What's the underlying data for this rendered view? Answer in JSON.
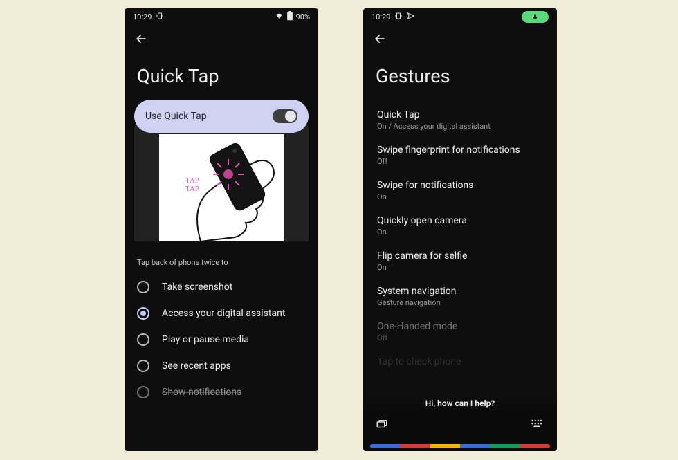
{
  "left": {
    "status": {
      "time": "10:29",
      "battery_text": "90%"
    },
    "title": "Quick Tap",
    "toggle_label": "Use Quick Tap",
    "illustration_caption": "TAP TAP",
    "section_label": "Tap back of phone twice to",
    "options": [
      {
        "label": "Take screenshot",
        "selected": false
      },
      {
        "label": "Access your digital assistant",
        "selected": true
      },
      {
        "label": "Play or pause media",
        "selected": false
      },
      {
        "label": "See recent apps",
        "selected": false
      },
      {
        "label": "Show notifications",
        "selected": false,
        "cutoff": true
      }
    ]
  },
  "right": {
    "status": {
      "time": "10:29"
    },
    "title": "Gestures",
    "items": [
      {
        "title": "Quick Tap",
        "sub": "On / Access your digital assistant"
      },
      {
        "title": "Swipe fingerprint for notifications",
        "sub": "Off"
      },
      {
        "title": "Swipe for notifications",
        "sub": "On"
      },
      {
        "title": "Quickly open camera",
        "sub": "On"
      },
      {
        "title": "Flip camera for selfie",
        "sub": "On"
      },
      {
        "title": "System navigation",
        "sub": "Gesture navigation"
      },
      {
        "title": "One-Handed mode",
        "sub": "Off",
        "dim": true
      },
      {
        "title": "Tap to check phone",
        "sub": "",
        "dim": true
      }
    ],
    "assistant_prompt": "Hi, how can I help?",
    "assistant_colors": [
      "#3a6bdd",
      "#d83a3a",
      "#f4b400",
      "#3a6bdd",
      "#0f9d58",
      "#d83a3a"
    ]
  }
}
